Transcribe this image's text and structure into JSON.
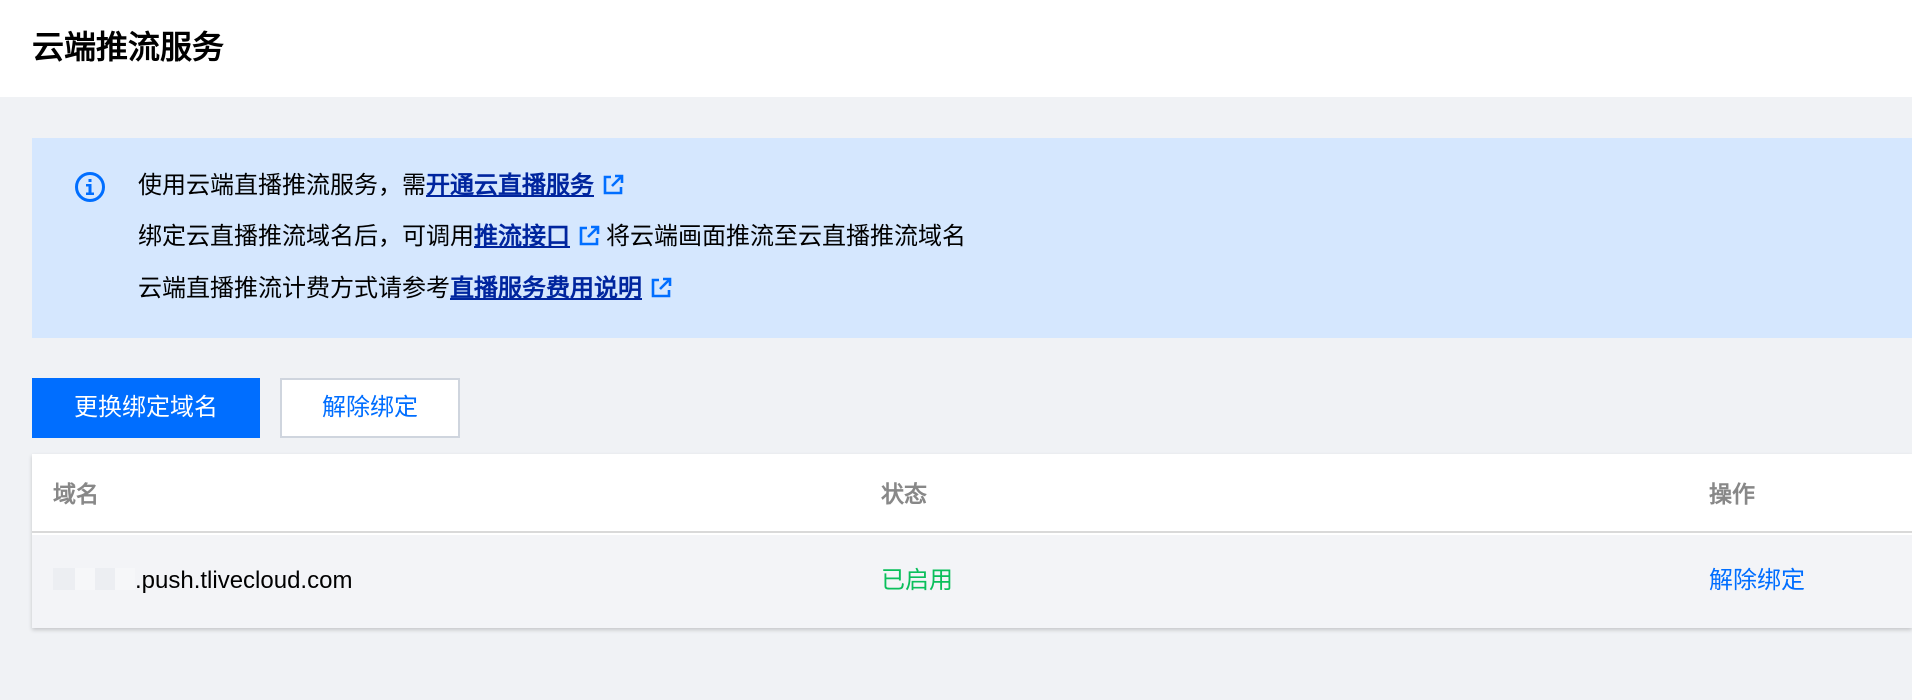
{
  "header": {
    "title": "云端推流服务"
  },
  "notice": {
    "icon": "info-icon",
    "line1": {
      "text": "使用云端直播推流服务，需",
      "link": "开通云直播服务"
    },
    "line2": {
      "text_before": "绑定云直播推流域名后，可调用",
      "link": "推流接口",
      "text_after": "将云端画面推流至云直播推流域名"
    },
    "line3": {
      "text": "云端直播推流计费方式请参考",
      "link": "直播服务费用说明"
    }
  },
  "toolbar": {
    "change_domain_label": "更换绑定域名",
    "unbind_label": "解除绑定"
  },
  "table": {
    "columns": [
      "域名",
      "状态",
      "操作"
    ],
    "rows": [
      {
        "domain": ".push.tlivecloud.com",
        "status": "已启用",
        "action": "解除绑定"
      }
    ]
  },
  "colors": {
    "accent": "#006eff",
    "notice_bg": "#d5e7fe",
    "link": "#00259e",
    "status_enabled": "#0abf5b"
  }
}
